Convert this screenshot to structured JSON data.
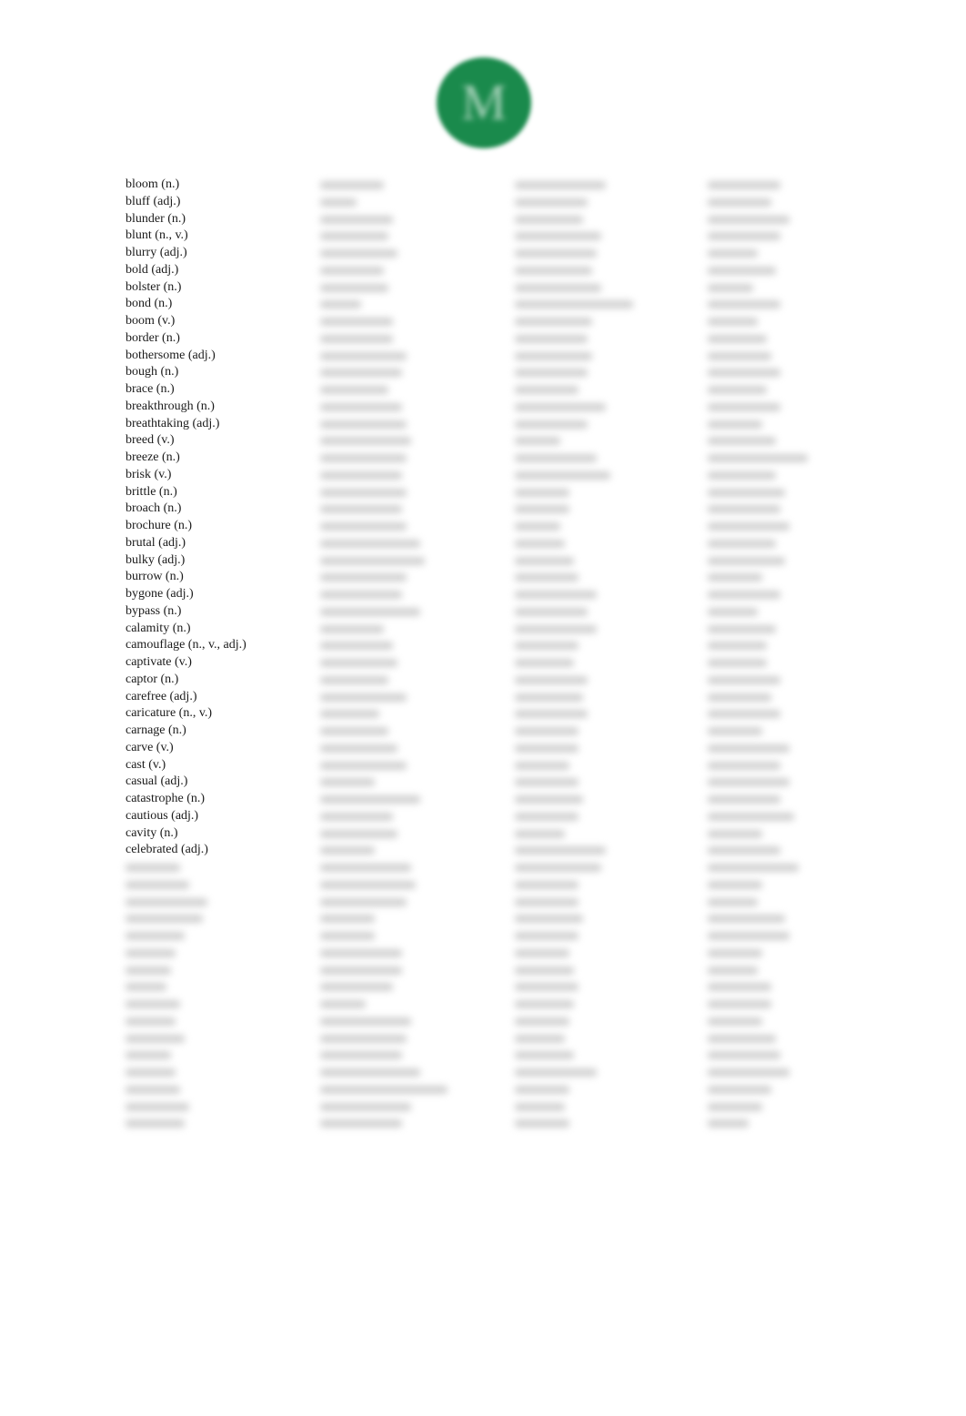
{
  "logo": {
    "letter": "M",
    "color": "#1a8a4c"
  },
  "word_list": {
    "visible_words": [
      "bloom (n.)",
      "bluff (adj.)",
      "blunder (n.)",
      "blunt (n., v.)",
      "blurry (adj.)",
      "bold (adj.)",
      "bolster (n.)",
      "bond (n.)",
      "boom (v.)",
      "border (n.)",
      "bothersome (adj.)",
      "bough (n.)",
      "brace (n.)",
      "breakthrough (n.)",
      "breathtaking (adj.)",
      "breed (v.)",
      "breeze (n.)",
      "brisk (v.)",
      "brittle (n.)",
      "broach (n.)",
      "brochure (n.)",
      "brutal (adj.)",
      "bulky (adj.)",
      "burrow (n.)",
      "bygone (adj.)",
      "bypass (n.)",
      "calamity (n.)",
      "camouflage (n., v., adj.)",
      "captivate (v.)",
      "captor (n.)",
      "carefree (adj.)",
      "caricature (n., v.)",
      "carnage (n.)",
      "carve (v.)",
      "cast (v.)",
      "casual (adj.)",
      "catastrophe (n.)",
      "cautious (adj.)",
      "cavity (n.)",
      "celebrated (adj.)"
    ],
    "blurred_rows_col1": 16,
    "blurred_rows_per_other_column": 56,
    "blurred_columns": 3
  }
}
